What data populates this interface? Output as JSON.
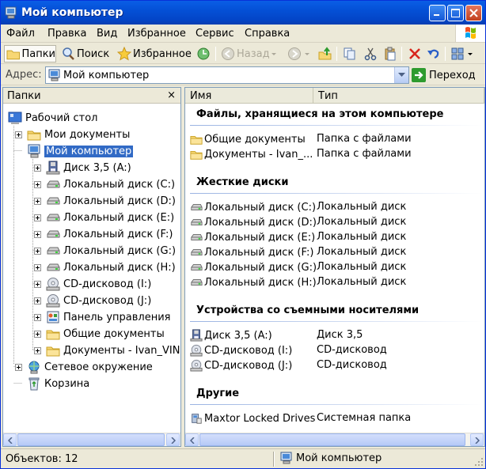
{
  "window": {
    "title": "Мой компьютер"
  },
  "menu": [
    "Файл",
    "Правка",
    "Вид",
    "Избранное",
    "Сервис",
    "Справка"
  ],
  "toolbar": {
    "folders": "Папки",
    "search": "Поиск",
    "favorites": "Избранное",
    "back": "Назад"
  },
  "address": {
    "label": "Адрес:",
    "value": "Мой компьютер",
    "go": "Переход"
  },
  "folders_pane": {
    "title": "Папки",
    "close": "×",
    "tree": [
      {
        "label": "Рабочий стол",
        "icon": "desktop-icon",
        "level": 0
      },
      {
        "label": "Мои документы",
        "icon": "folder-icon",
        "level": 1
      },
      {
        "label": "Мой компьютер",
        "icon": "computer-icon",
        "level": 1,
        "selected": true
      },
      {
        "label": "Диск 3,5 (A:)",
        "icon": "floppy-icon",
        "level": 2
      },
      {
        "label": "Локальный диск (C:)",
        "icon": "disk-icon",
        "level": 2
      },
      {
        "label": "Локальный диск (D:)",
        "icon": "disk-icon",
        "level": 2
      },
      {
        "label": "Локальный диск (E:)",
        "icon": "disk-icon",
        "level": 2
      },
      {
        "label": "Локальный диск (F:)",
        "icon": "disk-icon",
        "level": 2
      },
      {
        "label": "Локальный диск (G:)",
        "icon": "disk-icon",
        "level": 2
      },
      {
        "label": "Локальный диск (H:)",
        "icon": "disk-icon",
        "level": 2
      },
      {
        "label": "CD-дисковод (I:)",
        "icon": "cd-icon",
        "level": 2
      },
      {
        "label": "CD-дисковод (J:)",
        "icon": "cd-icon",
        "level": 2
      },
      {
        "label": "Панель управления",
        "icon": "control-panel-icon",
        "level": 2
      },
      {
        "label": "Общие документы",
        "icon": "folder-icon",
        "level": 2
      },
      {
        "label": "Документы - Ivan_VIN",
        "icon": "folder-icon",
        "level": 2
      },
      {
        "label": "Сетевое окружение",
        "icon": "network-icon",
        "level": 1
      },
      {
        "label": "Корзина",
        "icon": "recycle-bin-icon",
        "level": 1
      }
    ]
  },
  "columns": {
    "name": "Имя",
    "type": "Тип"
  },
  "groups": [
    {
      "title": "Файлы, хранящиеся на этом компьютере",
      "items": [
        {
          "name": "Общие документы",
          "type": "Папка с файлами",
          "icon": "folder-icon"
        },
        {
          "name": "Документы - Ivan_...",
          "type": "Папка с файлами",
          "icon": "folder-icon"
        }
      ]
    },
    {
      "title": "Жесткие диски",
      "items": [
        {
          "name": "Локальный диск (C:)",
          "type": "Локальный диск",
          "icon": "disk-icon"
        },
        {
          "name": "Локальный диск (D:)",
          "type": "Локальный диск",
          "icon": "disk-icon"
        },
        {
          "name": "Локальный диск (E:)",
          "type": "Локальный диск",
          "icon": "disk-icon"
        },
        {
          "name": "Локальный диск (F:)",
          "type": "Локальный диск",
          "icon": "disk-icon"
        },
        {
          "name": "Локальный диск (G:)",
          "type": "Локальный диск",
          "icon": "disk-icon"
        },
        {
          "name": "Локальный диск (H:)",
          "type": "Локальный диск",
          "icon": "disk-icon"
        }
      ]
    },
    {
      "title": "Устройства со съемными носителями",
      "items": [
        {
          "name": "Диск 3,5 (A:)",
          "type": "Диск 3,5",
          "icon": "floppy-icon"
        },
        {
          "name": "CD-дисковод (I:)",
          "type": "CD-дисковод",
          "icon": "cd-icon"
        },
        {
          "name": "CD-дисковод (J:)",
          "type": "CD-дисковод",
          "icon": "cd-icon"
        }
      ]
    },
    {
      "title": "Другие",
      "items": [
        {
          "name": "Maxtor Locked Drives",
          "type": "Системная папка",
          "icon": "system-folder-icon"
        }
      ]
    }
  ],
  "status": {
    "objects": "Объектов: 12",
    "location": "Мой компьютер"
  },
  "colors": {
    "titlebar": "#0450d6",
    "selection": "#316ac5",
    "chrome": "#ece9d8"
  }
}
